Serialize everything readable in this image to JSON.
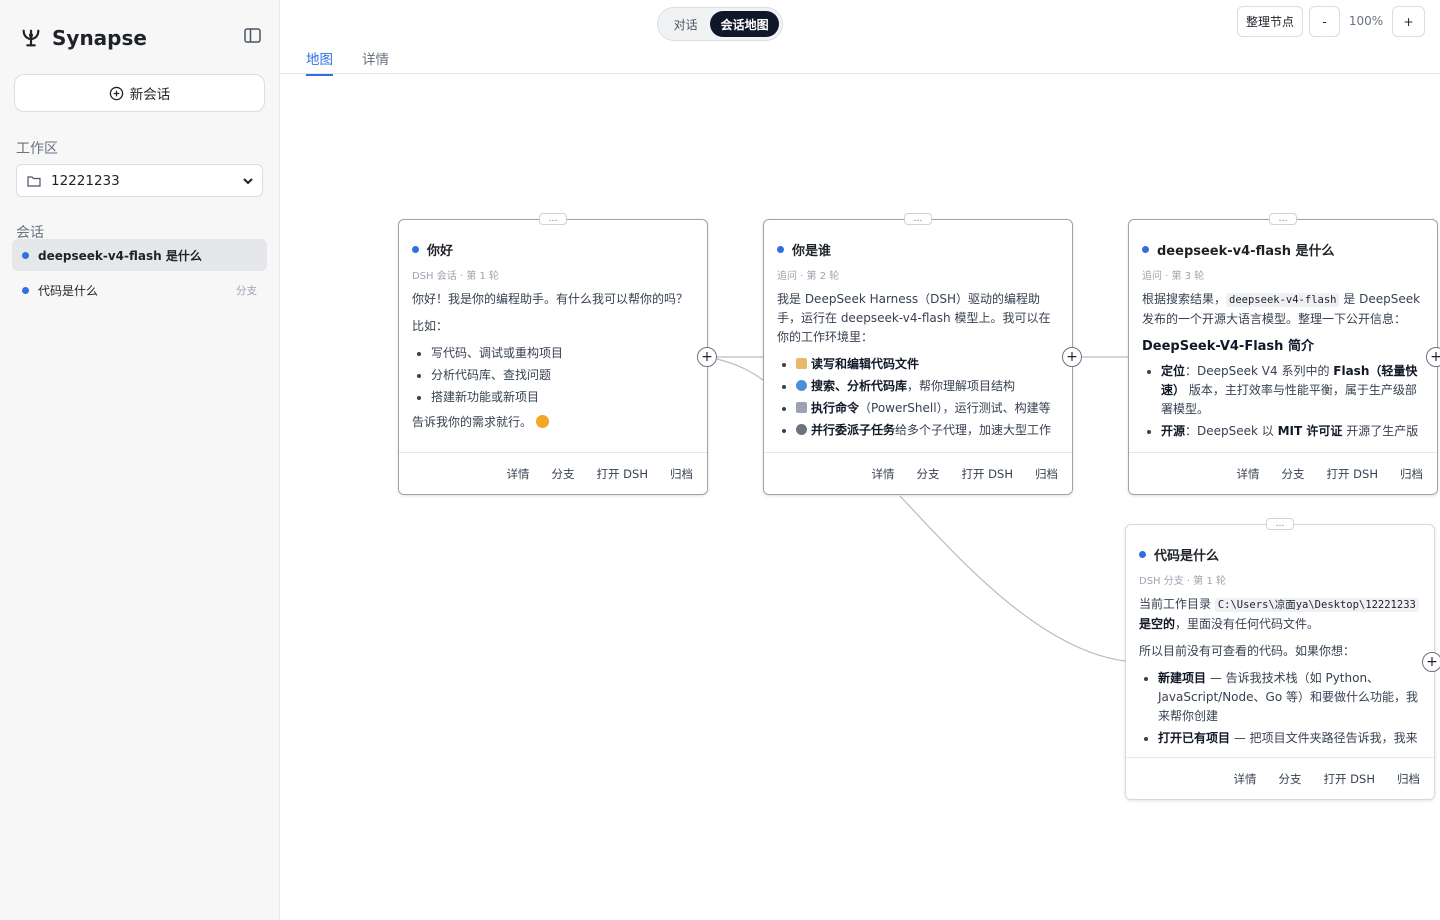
{
  "app": {
    "name": "Synapse"
  },
  "sidebar": {
    "new_session_label": "新会话",
    "workspace_label": "工作区",
    "workspace_value": "12221233",
    "sessions_label": "会话",
    "sessions": [
      {
        "title": "deepseek-v4-flash 是什么",
        "tag": ""
      },
      {
        "title": "代码是什么",
        "tag": "分支"
      }
    ]
  },
  "top": {
    "view_toggle": {
      "chat": "对话",
      "map": "会话地图"
    },
    "tabs": {
      "map": "地图",
      "details": "详情"
    },
    "tidy_label": "整理节点",
    "zoom_out": "-",
    "zoom_level": "100%",
    "zoom_in": "+"
  },
  "nodes": {
    "n1": {
      "title": "你好",
      "source": "DSH 会话",
      "turn": "第 1 轮",
      "p1": "你好！我是你的编程助手。有什么我可以帮你的吗？",
      "p2": "比如：",
      "items": [
        "写代码、调试或重构项目",
        "分析代码库、查找问题",
        "搭建新功能或新项目"
      ],
      "p3": "告诉我你的需求就行。"
    },
    "n2": {
      "title": "你是谁",
      "source": "追问",
      "turn": "第 2 轮",
      "p1": "我是 DeepSeek Harness（DSH）驱动的编程助手，运行在 deepseek-v4-flash 模型上。我可以在你的工作环境里：",
      "items": [
        {
          "bold": "读写和编辑代码文件",
          "rest": ""
        },
        {
          "bold": "搜索、分析代码库",
          "rest": "，帮你理解项目结构"
        },
        {
          "bold": "执行命令",
          "rest": "（PowerShell），运行测试、构建等"
        },
        {
          "bold": "并行委派子任务",
          "rest": "给多个子代理，加速大型工作"
        }
      ]
    },
    "n3": {
      "title": "deepseek-v4-flash 是什么",
      "source": "追问",
      "turn": "第 3 轮",
      "p1a": "根据搜索结果，",
      "p1code": "deepseek-v4-flash",
      "p1b": " 是 DeepSeek 发布的一个开源大语言模型。整理一下公开信息：",
      "heading": "DeepSeek-V4-Flash 简介",
      "li1_label": "定位",
      "li1_a": "：DeepSeek V4 系列中的 ",
      "li1_b": "Flash（轻量快速）",
      "li1_c": " 版本，主打效率与性能平衡，属于生产级部署模型。",
      "li2_label": "开源",
      "li2_a": "：DeepSeek 以 ",
      "li2_b": "MIT 许可证",
      "li2_c": " 开源了生产版"
    },
    "n4": {
      "title": "代码是什么",
      "source": "DSH 分支",
      "turn": "第 1 轮",
      "p1a": "当前工作目录 ",
      "p1code": "C:\\Users\\凉面ya\\Desktop\\12221233",
      "p1b": " ",
      "p1bold": "是空的",
      "p1c": "，里面没有任何代码文件。",
      "p2": "所以目前没有可查看的代码。如果你想：",
      "li1_label": "新建项目",
      "li1_text": " — 告诉我技术栈（如 Python、JavaScript/Node、Go 等）和要做什么功能，我来帮你创建",
      "li2_label": "打开已有项目",
      "li2_text": " — 把项目文件夹路径告诉我，我来"
    }
  },
  "node_actions": {
    "details": "详情",
    "branch": "分支",
    "open": "打开 DSH",
    "archive": "归档"
  },
  "handle_label": "…",
  "plus_label": "+",
  "colors": {
    "accent": "#2f6fe0",
    "dark": "#0f172a"
  }
}
